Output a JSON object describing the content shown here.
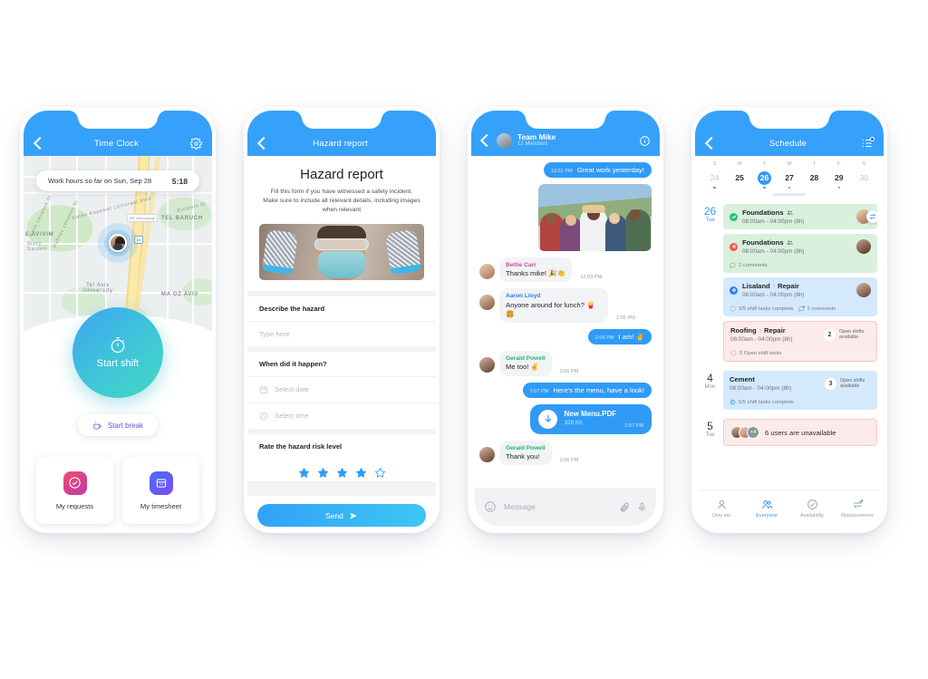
{
  "colors": {
    "brand_blue": "#36a1fb",
    "accent_teal": "#45d7c2",
    "pink": "#ef4d6e",
    "purple": "#7a4df4",
    "green": "#28c76f",
    "red": "#f2564f"
  },
  "phone1": {
    "header": {
      "title": "Time Clock",
      "back_icon": "back-chevron-icon",
      "settings_icon": "gear-icon"
    },
    "hours_banner": {
      "label": "Work hours so far on Sun, Sep 28",
      "value": "5:18"
    },
    "map_labels": [
      "TEL BARUCH",
      "E AVIVIM",
      "MA OZ AVIV",
      "Tel Aviv University",
      "Karen Kayemet LeYisrael Blvd",
      "Sissy Garden",
      "Dubnov Levanon St",
      "Mordekhai Romano St",
      "Einstein St",
      "Haim Levanon St"
    ],
    "map_badges": [
      "RR Interchange",
      "66"
    ],
    "start_shift": {
      "label": "Start shift",
      "icon": "stopwatch-icon"
    },
    "start_break": {
      "label": "Start break",
      "icon": "coffee-cup-icon"
    },
    "tiles": [
      {
        "label": "My requests",
        "icon": "check-circle-icon"
      },
      {
        "label": "My timesheet",
        "icon": "timesheet-icon"
      }
    ]
  },
  "phone2": {
    "header": {
      "title": "Hazard report",
      "back_icon": "back-chevron-icon"
    },
    "title": "Hazard report",
    "subtitle": "Fill this form if you have witnessed a safety incident. Make sure to include all relevant details, including images when relevant",
    "image_alt": "worker-with-safety-goggles-and-mask",
    "sections": [
      {
        "heading": "Describe the  hazard",
        "fields": [
          {
            "placeholder": "Type here",
            "icon": null
          }
        ]
      },
      {
        "heading": "When did it happen?",
        "fields": [
          {
            "placeholder": "Select date",
            "icon": "calendar-icon"
          },
          {
            "placeholder": "Select time",
            "icon": "clock-icon"
          }
        ]
      },
      {
        "heading": "Rate the hazard risk level",
        "fields": []
      }
    ],
    "rating": {
      "filled": 4,
      "total": 5
    },
    "send_button": {
      "label": "Send",
      "icon": "send-arrow-icon"
    }
  },
  "phone3": {
    "header": {
      "title": "Team Mike",
      "subtitle": "12 Members",
      "back_icon": "back-chevron-icon",
      "info_icon": "info-circle-icon"
    },
    "messages": [
      {
        "type": "out-text",
        "time": "12:01 PM",
        "text": "Great work yesterday!"
      },
      {
        "type": "out-photo",
        "alt": "group-selfie-photo"
      },
      {
        "type": "in-text",
        "sender": "Bettie Carr",
        "sender_color": "pink",
        "text": "Thanks mike! 🎉👏",
        "time": "12:03 PM"
      },
      {
        "type": "in-text",
        "sender": "Aaron Lloyd",
        "sender_color": "blue",
        "text": "Anyone around for lunch? 🍟🍔",
        "time": "2:05 PM"
      },
      {
        "type": "out-text",
        "time": "2:06 PM",
        "text": "I am! ✌️"
      },
      {
        "type": "in-text",
        "sender": "Gerald Powell",
        "sender_color": "green",
        "text": "Me too! ✌️",
        "time": "2:06 PM"
      },
      {
        "type": "out-text",
        "time": "2:07 PM",
        "text": "Here's the menu, have a look!"
      },
      {
        "type": "out-file",
        "name": "New Menu.PDF",
        "size": "328 Kb",
        "time": "2:07 PM",
        "icon": "download-arrow-icon"
      },
      {
        "type": "in-text",
        "sender": "Gerald Powell",
        "sender_color": "green",
        "text": "Thank you!",
        "time": "2:06 PM"
      }
    ],
    "composer": {
      "placeholder": "Message",
      "emoji_icon": "smiley-icon",
      "attach_icon": "paperclip-icon",
      "mic_icon": "microphone-icon"
    }
  },
  "phone4": {
    "header": {
      "title": "Schedule",
      "back_icon": "back-chevron-icon",
      "list_icon": "task-list-icon"
    },
    "calendar": {
      "dow": [
        "S",
        "M",
        "T",
        "W",
        "T",
        "F",
        "S"
      ],
      "days": [
        {
          "n": "24",
          "dim": true,
          "selected": false,
          "dot": true
        },
        {
          "n": "25",
          "dim": false,
          "selected": false,
          "dot": false
        },
        {
          "n": "26",
          "dim": false,
          "selected": true,
          "dot": true
        },
        {
          "n": "27",
          "dim": false,
          "selected": false,
          "dot": true
        },
        {
          "n": "28",
          "dim": false,
          "selected": false,
          "dot": false
        },
        {
          "n": "29",
          "dim": false,
          "selected": false,
          "dot": true
        },
        {
          "n": "30",
          "dim": true,
          "selected": false,
          "dot": false
        }
      ]
    },
    "days": [
      {
        "num": "26",
        "weekday": "Tue",
        "highlight": true,
        "cards": [
          {
            "tone": "green",
            "status": "ok",
            "title": "Foundations",
            "sep": null,
            "title2": null,
            "group_icon": "people-icon",
            "time": "08:00am - 04:00pm (8h)",
            "avatar": "m1",
            "swap": true,
            "foot": []
          },
          {
            "tone": "green",
            "status": "no",
            "title": "Foundations",
            "sep": null,
            "title2": null,
            "group_icon": "people-icon",
            "time": "08:00am - 04:00pm (8h)",
            "avatar": "m2",
            "swap": false,
            "foot": [
              {
                "icon": "comment-icon",
                "label": "2 comments"
              }
            ]
          },
          {
            "tone": "blue",
            "status": "q",
            "title": "Lisaland",
            "sep": "›",
            "title2": "Repair",
            "group_icon": null,
            "time": "08:00am - 04:00pm (8h)",
            "avatar": "m3",
            "swap": false,
            "foot": [
              {
                "icon": "progress-icon",
                "label": "3/5 shift tasks complete"
              },
              {
                "icon": "comment-dot-icon",
                "label": "2 comments"
              }
            ]
          },
          {
            "tone": "pinkb",
            "status": null,
            "title": "Roofing",
            "sep": "›",
            "title2": "Repair",
            "group_icon": null,
            "time": "08:00am - 04:00pm (8h)",
            "open_shifts": {
              "count": "2",
              "label": "Open shifts available"
            },
            "foot": [
              {
                "icon": "circle-outline-icon",
                "label": "5 Open shift tasks"
              }
            ]
          }
        ]
      },
      {
        "num": "4",
        "weekday": "Mon",
        "highlight": false,
        "cards": [
          {
            "tone": "blue",
            "status": null,
            "title": "Cement",
            "sep": null,
            "title2": null,
            "group_icon": null,
            "time": "08:00am - 04:00pm (8h)",
            "open_shifts": {
              "count": "3",
              "label": "Open shifts available"
            },
            "foot": [
              {
                "icon": "check-filled-icon",
                "label": "5/5 shift tasks complete"
              }
            ]
          }
        ]
      },
      {
        "num": "5",
        "weekday": "Tue",
        "highlight": false,
        "unavailable": {
          "extra": "+4",
          "label": "6 users are unavailable"
        }
      }
    ],
    "bottom_nav": [
      {
        "label": "Only me",
        "icon": "single-person-icon",
        "active": false
      },
      {
        "label": "Everyone",
        "icon": "group-people-icon",
        "active": true
      },
      {
        "label": "Availability",
        "icon": "check-circle-outline-icon",
        "active": false
      },
      {
        "label": "Replacements",
        "icon": "swap-arrows-icon",
        "active": false
      }
    ]
  }
}
